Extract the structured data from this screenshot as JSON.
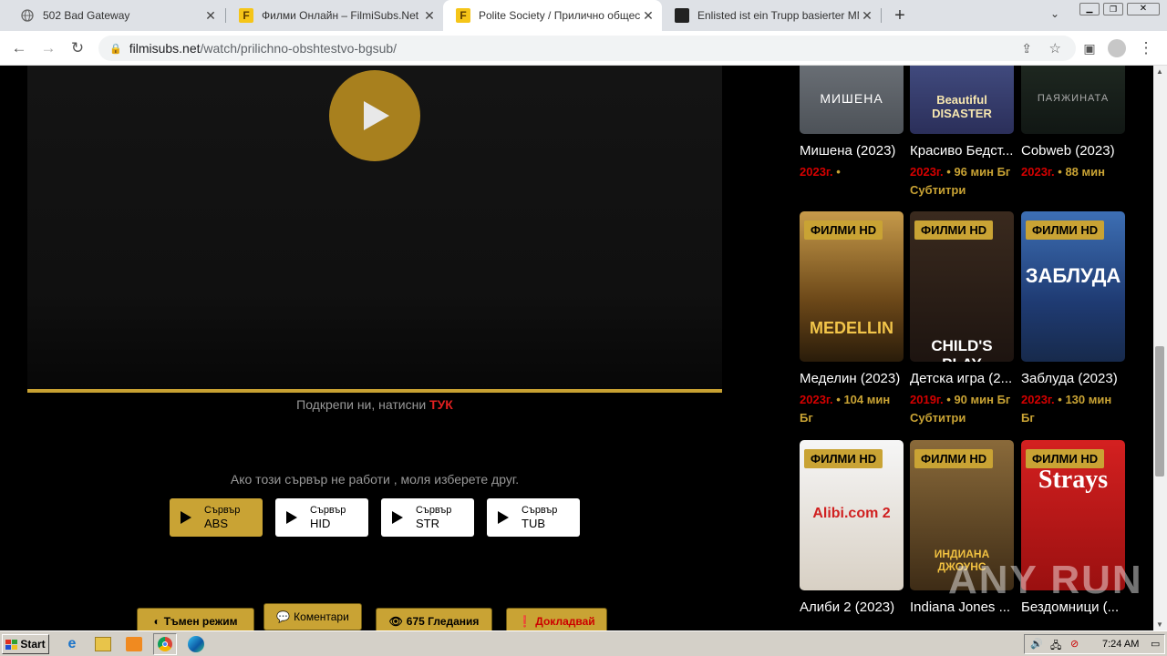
{
  "browser": {
    "tabs": [
      {
        "title": "502 Bad Gateway",
        "icon": "globe-icon"
      },
      {
        "title": "Филми Онлайн – FilmiSubs.Net",
        "icon": "filmisubs-favicon"
      },
      {
        "title": "Polite Society / Прилично обществ",
        "icon": "filmisubs-favicon"
      },
      {
        "title": "Enlisted ist ein Trupp basierter MMO-",
        "icon": "enlisted-favicon"
      }
    ],
    "url_domain": "filmisubs.net",
    "url_path": "/watch/prilichno-obshtestvo-bgsub/"
  },
  "player": {
    "support_text": "Подкрепи ни, натисни",
    "support_link": "ТУК"
  },
  "servers": {
    "prompt": "Ако този сървър не работи , моля изберете друг.",
    "label": "Сървър",
    "items": [
      "ABS",
      "HID",
      "STR",
      "TUB"
    ]
  },
  "actions": {
    "dark_mode": "Тъмен режим",
    "comments": "Коментари",
    "views": "675 Гледания",
    "report": "Докладвай"
  },
  "sidebar": {
    "badge": "ФИЛМИ HD",
    "cards": [
      {
        "title": "Мишена (2023)",
        "year": "2023г.",
        "meta": "",
        "poster_text": "МИШЕНА"
      },
      {
        "title": "Красиво Бедст...",
        "year": "2023г.",
        "meta": "96 мин Бг Субтитри",
        "poster_text": "Beautiful DISASTER"
      },
      {
        "title": "Cobweb (2023)",
        "year": "2023г.",
        "meta": "88 мин",
        "poster_text": "ПАЯЖИНАТА"
      },
      {
        "title": "Меделин (2023)",
        "year": "2023г.",
        "meta": "104 мин Бг",
        "poster_text": "MEDELLIN"
      },
      {
        "title": "Детска игра (2...",
        "year": "2019г.",
        "meta": "90 мин Бг Субтитри",
        "poster_text": "CHILD'S PLAY"
      },
      {
        "title": "Заблуда (2023)",
        "year": "2023г.",
        "meta": "130 мин Бг",
        "poster_text": "ЗАБЛУДА"
      },
      {
        "title": "Алиби 2 (2023)",
        "year": "",
        "meta": "",
        "poster_text": "Alibi.com 2"
      },
      {
        "title": "Indiana Jones ...",
        "year": "",
        "meta": "",
        "poster_text": "ИНДИАНА ДЖОУНС"
      },
      {
        "title": "Бездомници (...",
        "year": "",
        "meta": "",
        "poster_text": "Strays"
      }
    ]
  },
  "taskbar": {
    "start": "Start",
    "time": "7:24 AM"
  },
  "watermark": "ANY RUN"
}
